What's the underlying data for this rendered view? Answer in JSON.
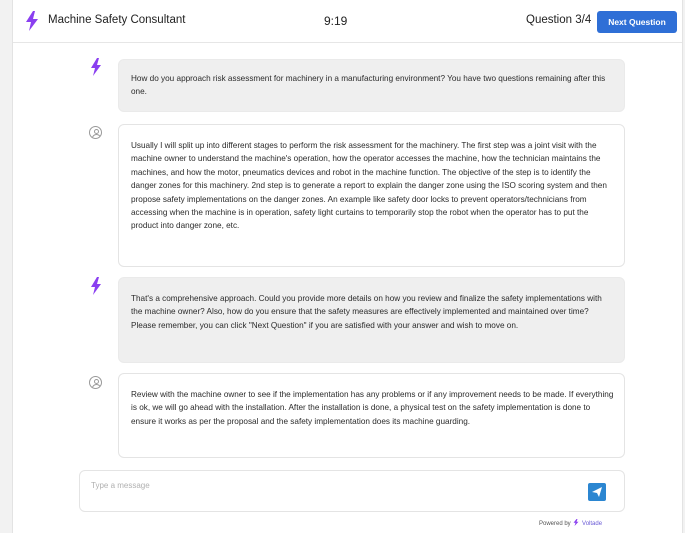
{
  "header": {
    "app_title": "Machine Safety Consultant",
    "timer": "9:19",
    "question_counter": "Question 3/4",
    "next_button": "Next Question"
  },
  "messages": [
    {
      "role": "bot",
      "text": "How do you approach risk assessment for machinery in a manufacturing environment? You have two questions remaining after this one."
    },
    {
      "role": "user",
      "text": "Usually I will split up into different stages to perform the risk assessment for the machinery. The first step was a joint visit with the machine owner to understand the machine's operation, how the operator accesses the machine, how the technician maintains the machines, and how the motor, pneumatics devices and robot in the machine function. The objective of the step is to identify the danger zones for this machinery. 2nd step is to generate a report to explain the danger zone using the ISO scoring system and then propose safety implementations on the danger zones. An example like safety door locks to prevent operators/technicians from accessing when the machine is in operation, safety light curtains to temporarily stop the robot when the operator has to put the product into danger zone, etc."
    },
    {
      "role": "bot",
      "text": "That's a comprehensive approach. Could you provide more details on how you review and finalize the safety implementations with the machine owner? Also, how do you ensure that the safety measures are effectively implemented and maintained over time? Please remember, you can click \"Next Question\" if you are satisfied with your answer and wish to move on."
    },
    {
      "role": "user",
      "text": "Review with the machine owner to see if the implementation has any problems or if any improvement needs to be made. If everything is ok, we will go ahead with the installation. After the installation is done, a physical test on the safety implementation is done to ensure it works as per the proposal and the safety implementation does its machine guarding."
    }
  ],
  "composer": {
    "placeholder": "Type a message",
    "value": ""
  },
  "footer": {
    "powered_by": "Powered by",
    "brand": "Voltade"
  },
  "colors": {
    "accent": "#2f6fd6",
    "bot_icon": "#8a3ff0",
    "bot_bubble": "#efefef",
    "send_button": "#2b86d1"
  },
  "icons": {
    "bot": "lightning-bolt-icon",
    "user": "user-circle-icon",
    "send": "send-icon"
  }
}
